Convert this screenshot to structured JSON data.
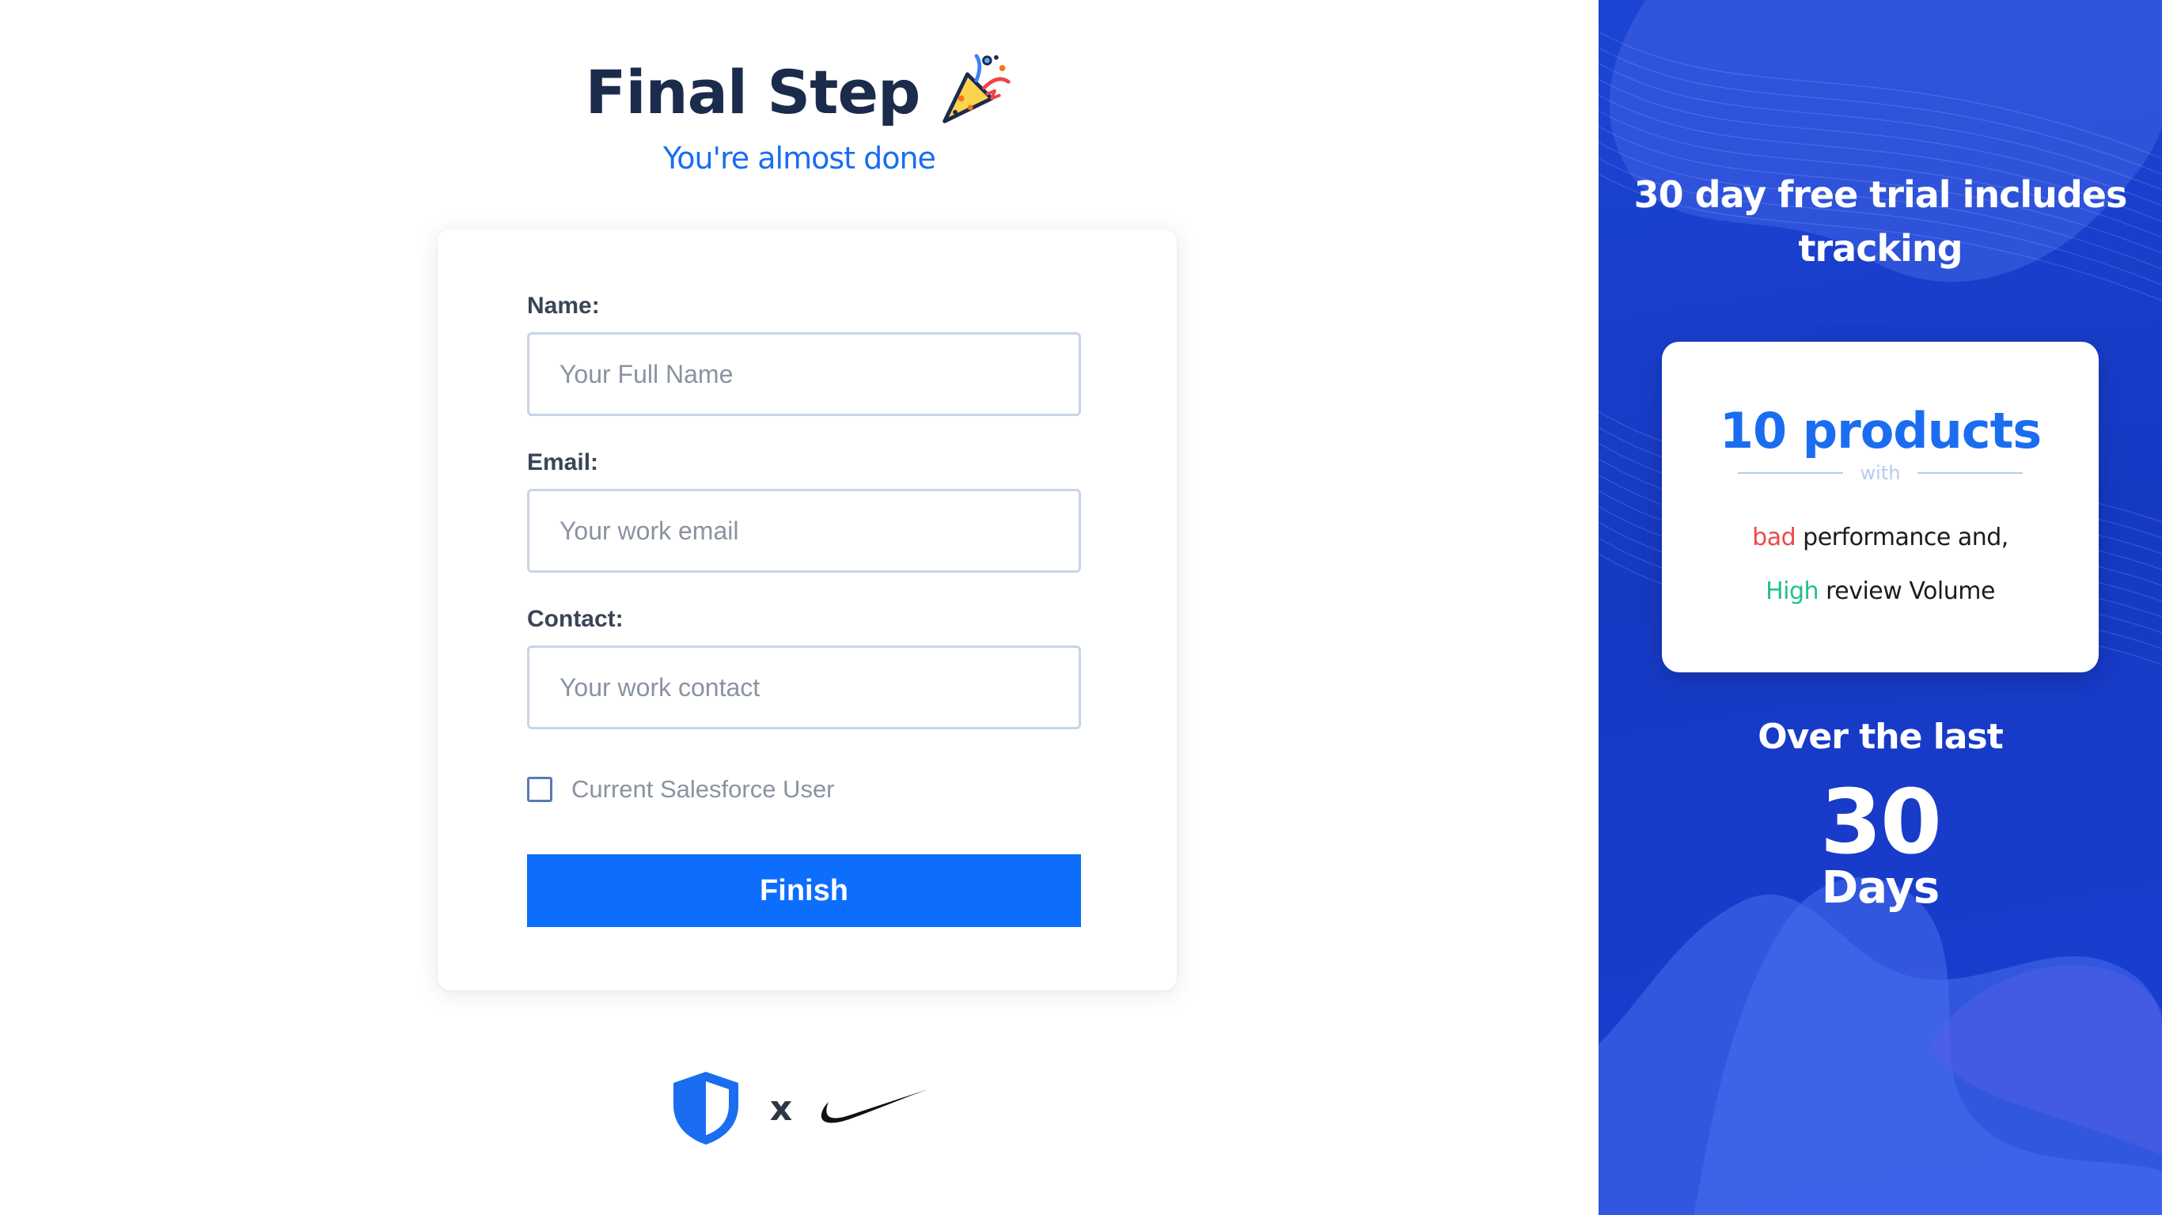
{
  "header": {
    "title": "Final Step",
    "subtitle": "You're almost done",
    "title_icon": "party-popper-icon"
  },
  "form": {
    "name_label": "Name:",
    "name_placeholder": "Your Full Name",
    "name_value": "",
    "email_label": "Email:",
    "email_placeholder": "Your work email",
    "email_value": "",
    "contact_label": "Contact:",
    "contact_placeholder": "Your work contact",
    "contact_value": "",
    "checkbox_label": "Current Salesforce User",
    "checkbox_checked": false,
    "submit_label": "Finish"
  },
  "brands": {
    "separator": "x",
    "left_logo": "shield-logo-icon",
    "right_logo": "nike-swoosh-icon"
  },
  "promo": {
    "trial_line1": "30 day free trial includes",
    "trial_line2": "tracking",
    "card": {
      "heading": "10 products",
      "divider_text": "with",
      "line1_highlight": "bad",
      "line1_rest": " performance and,",
      "line2_highlight": "High",
      "line2_rest": " review Volume"
    },
    "over_text": "Over the last",
    "number": "30",
    "unit": "Days"
  },
  "colors": {
    "primary": "#0d6efd",
    "title": "#1b2b4b",
    "subtitle": "#1a6df0",
    "panel": "#1d45d4",
    "bad": "#f04848",
    "high": "#22c08a"
  }
}
